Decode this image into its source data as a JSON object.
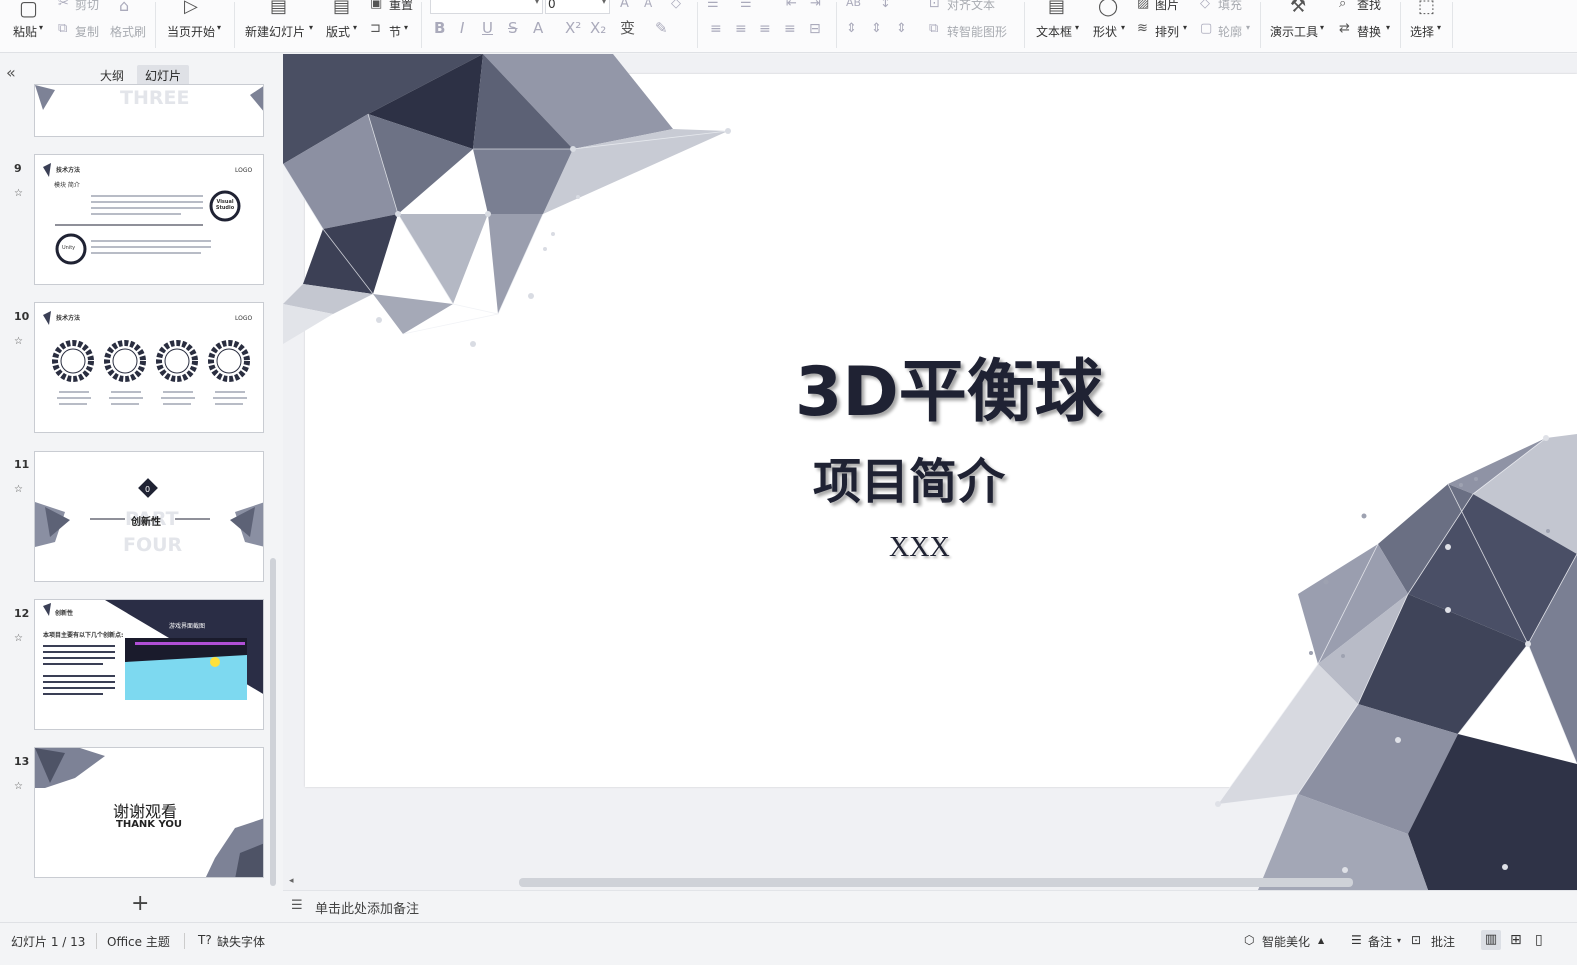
{
  "ribbon": {
    "paste": "粘贴",
    "cut": "剪切",
    "copy": "复制",
    "format_painter": "格式刷",
    "from_current": "当页开始",
    "new_slide": "新建幻灯片",
    "layout": "版式",
    "section": "节",
    "reset": "重置",
    "font_size_value": "0",
    "align_text": "对齐文本",
    "smartart": "转智能图形",
    "textbox": "文本框",
    "shape": "形状",
    "picture": "图片",
    "fill": "填充",
    "arrange": "排列",
    "outline": "轮廓",
    "present_tools": "演示工具",
    "find": "查找",
    "replace": "替换",
    "select": "选择"
  },
  "panel": {
    "tab_outline": "大纲",
    "tab_slides": "幻灯片",
    "collapse_glyph": "«",
    "add_glyph": "+",
    "thumbs": [
      {
        "num": "",
        "text": "THREE"
      },
      {
        "num": "9",
        "title": "技术方法",
        "subtitle": "模块 简介",
        "logo": "LOGO",
        "badge": "Visual Studio",
        "badge2": "Unity"
      },
      {
        "num": "10",
        "title": "技术方法",
        "logo": "LOGO"
      },
      {
        "num": "11",
        "badge": "0",
        "main": "创新性",
        "ghost1": "PART",
        "ghost2": "FOUR"
      },
      {
        "num": "12",
        "title": "创新性",
        "heading": "本项目主要有以下几个创新点:",
        "banner": "游戏界面截图"
      },
      {
        "num": "13",
        "cn": "谢谢观看",
        "en": "THANK YOU"
      }
    ]
  },
  "slide": {
    "title": "3D平衡球",
    "subtitle": "项目简介",
    "author": "XXX"
  },
  "notes": {
    "placeholder": "单击此处添加备注"
  },
  "status": {
    "slide_counter": "幻灯片 1 / 13",
    "theme": "Office 主题",
    "missing_fonts": "缺失字体",
    "beautify": "智能美化",
    "notes": "备注",
    "comments": "批注"
  }
}
